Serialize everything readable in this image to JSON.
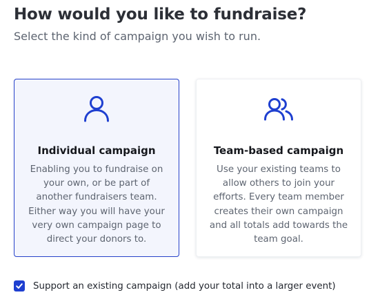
{
  "header": {
    "title": "How would you like to fundraise?",
    "subtitle": "Select the kind of campaign you wish to run."
  },
  "colors": {
    "accent": "#1e3fd0",
    "selected_card_bg": "#f3f5fd",
    "selected_card_border": "#2540c9"
  },
  "cards": [
    {
      "icon": "single-person-icon",
      "title": "Individual campaign",
      "description_lines": [
        "Enabling you to fundraise on",
        "your own, or be part of",
        "another fundraisers team.",
        "Either way you will have your",
        "very own campaign page to",
        "direct your donors to."
      ],
      "selected": true
    },
    {
      "icon": "group-people-icon",
      "title": "Team-based campaign",
      "description_lines": [
        "Use your existing teams to",
        "allow others to join your",
        "efforts. Every team member",
        "creates their own campaign",
        "and all totals add towards the",
        "team goal."
      ],
      "selected": false
    }
  ],
  "support_existing": {
    "checked": true,
    "label": "Support an existing campaign (add your total into a larger event)"
  }
}
